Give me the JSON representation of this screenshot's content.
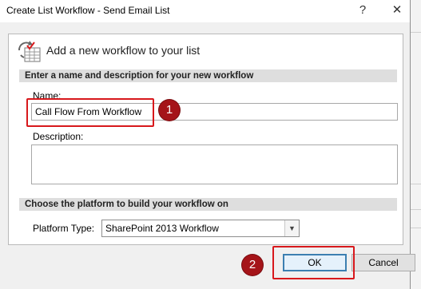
{
  "window": {
    "title": "Create List Workflow - Send Email List",
    "help_glyph": "?",
    "close_glyph": "✕"
  },
  "header": {
    "icon": "workflow-icon",
    "text": "Add a new workflow to your list"
  },
  "name_section": {
    "heading": "Enter a name and description for your new workflow",
    "name_label": "Name:",
    "name_value": "Call Flow From Workflow",
    "description_label": "Description:",
    "description_value": ""
  },
  "platform_section": {
    "heading": "Choose the platform to build your workflow on",
    "platform_label": "Platform Type:",
    "platform_value": "SharePoint 2013 Workflow"
  },
  "buttons": {
    "ok": "OK",
    "cancel": "Cancel"
  },
  "annotations": {
    "step1": "1",
    "step2": "2",
    "color": "#d8181c"
  }
}
